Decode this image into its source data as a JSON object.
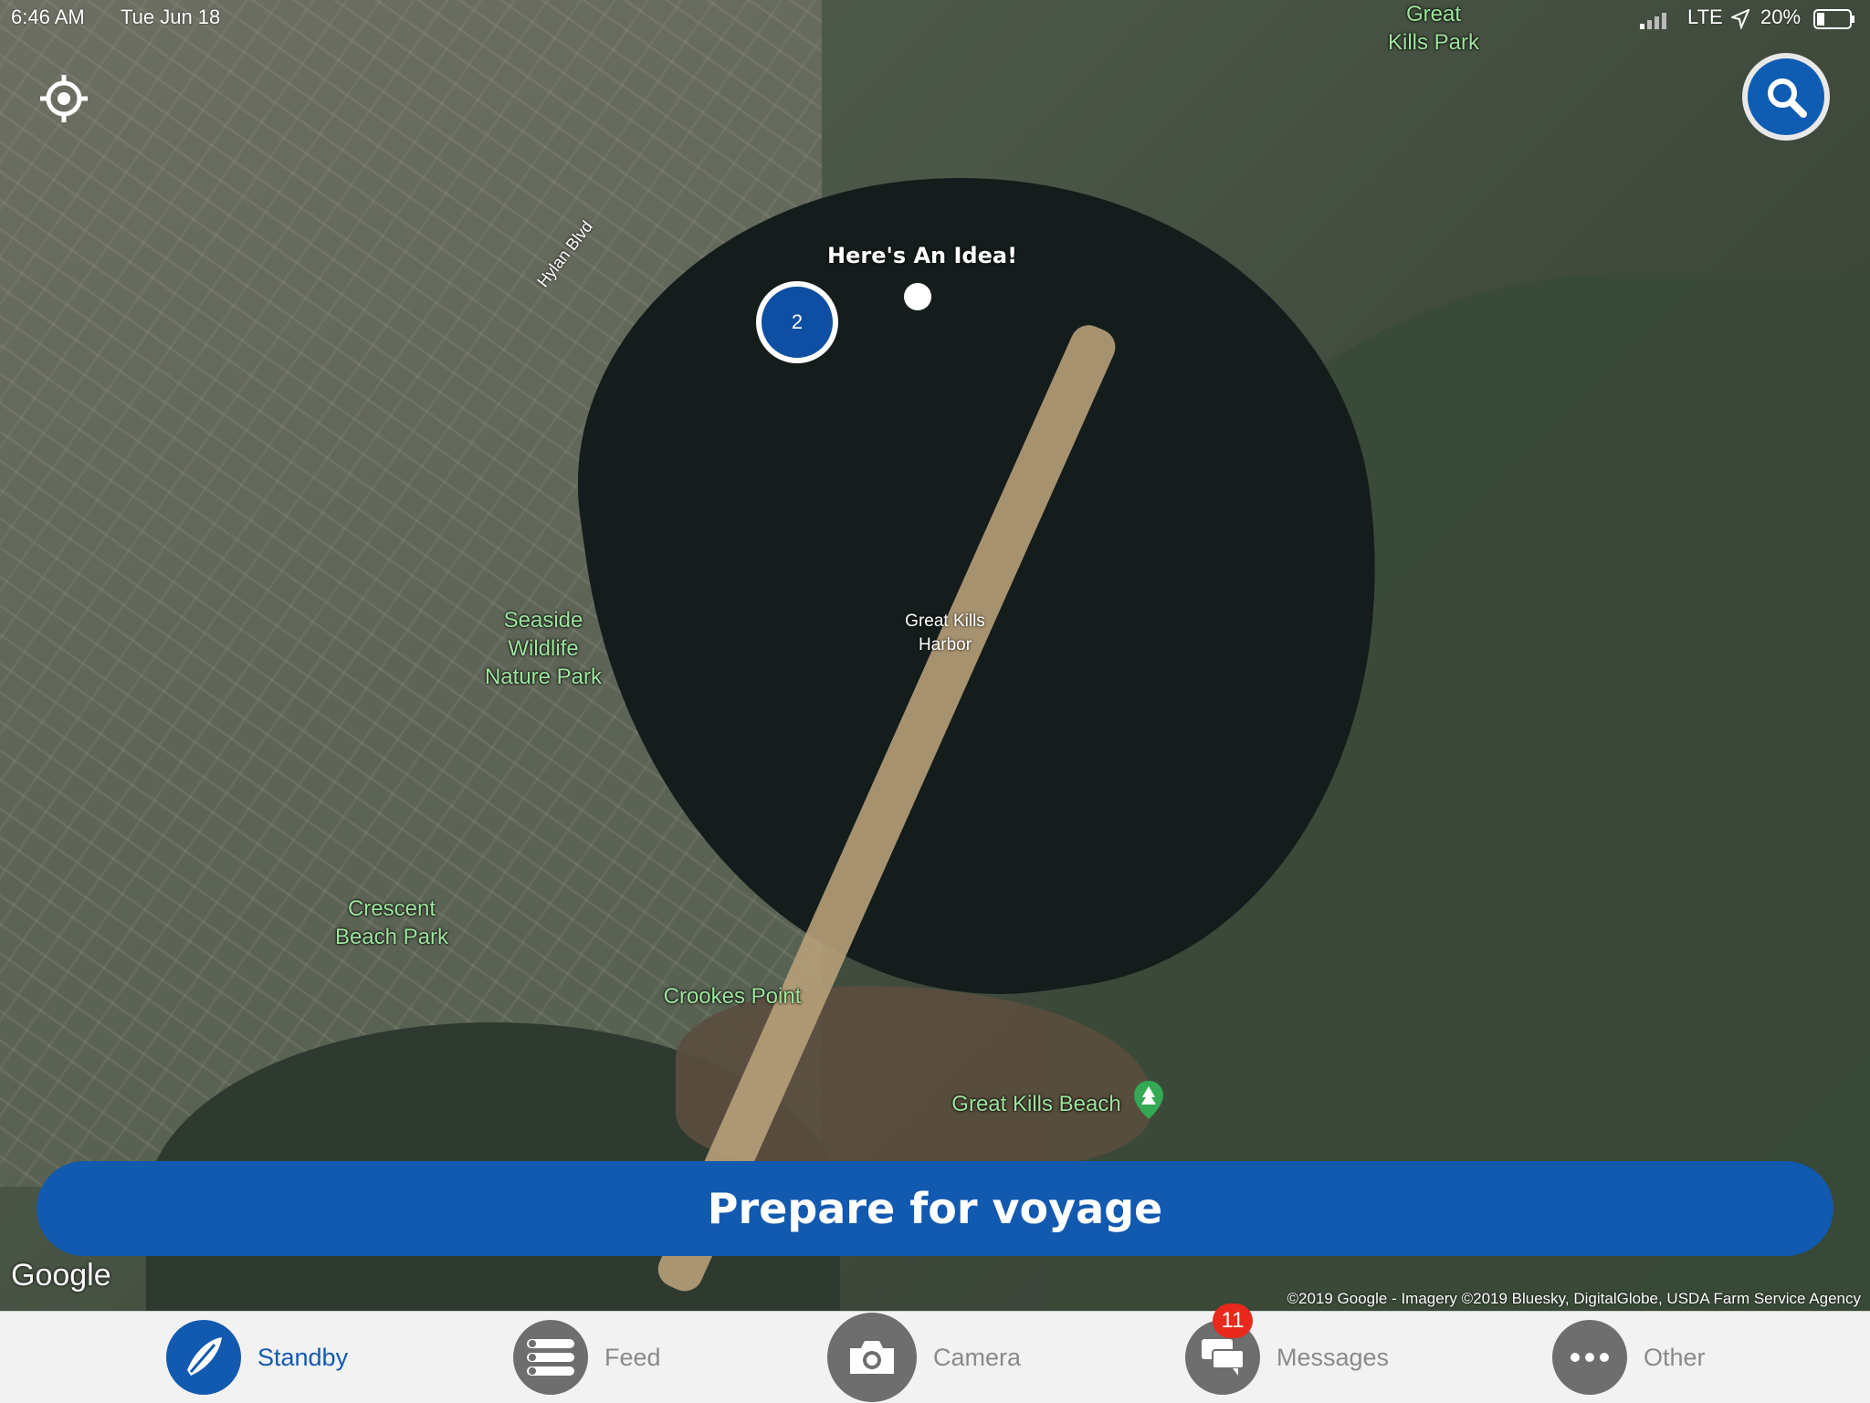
{
  "status_bar": {
    "time": "6:46 AM",
    "date": "Tue Jun 18",
    "network": "LTE",
    "battery": "20%"
  },
  "map": {
    "labels": {
      "great_kills_park": "Great\nKills Park",
      "hylan_blvd": "Hylan Blvd",
      "seaside": "Seaside\nWildlife\nNature Park",
      "harbor": "Great Kills\nHarbor",
      "crescent": "Crescent\nBeach Park",
      "crookes": "Crookes Point",
      "beach": "Great Kills Beach"
    },
    "cluster_count": "2",
    "idea_label": "Here's An Idea!",
    "google_logo": "Google",
    "attribution": "©2019 Google - Imagery ©2019 Bluesky, DigitalGlobe, USDA Farm Service Agency"
  },
  "actions": {
    "prepare_label": "Prepare for voyage"
  },
  "tabs": [
    {
      "label": "Standby",
      "icon": "boat-icon"
    },
    {
      "label": "Feed",
      "icon": "list-icon"
    },
    {
      "label": "Camera",
      "icon": "camera-icon"
    },
    {
      "label": "Messages",
      "icon": "chat-icon",
      "badge": "11"
    },
    {
      "label": "Other",
      "icon": "more-icon"
    }
  ],
  "colors": {
    "accent": "#1259b0",
    "badge": "#e8291c",
    "park_label": "#9ee59e"
  }
}
